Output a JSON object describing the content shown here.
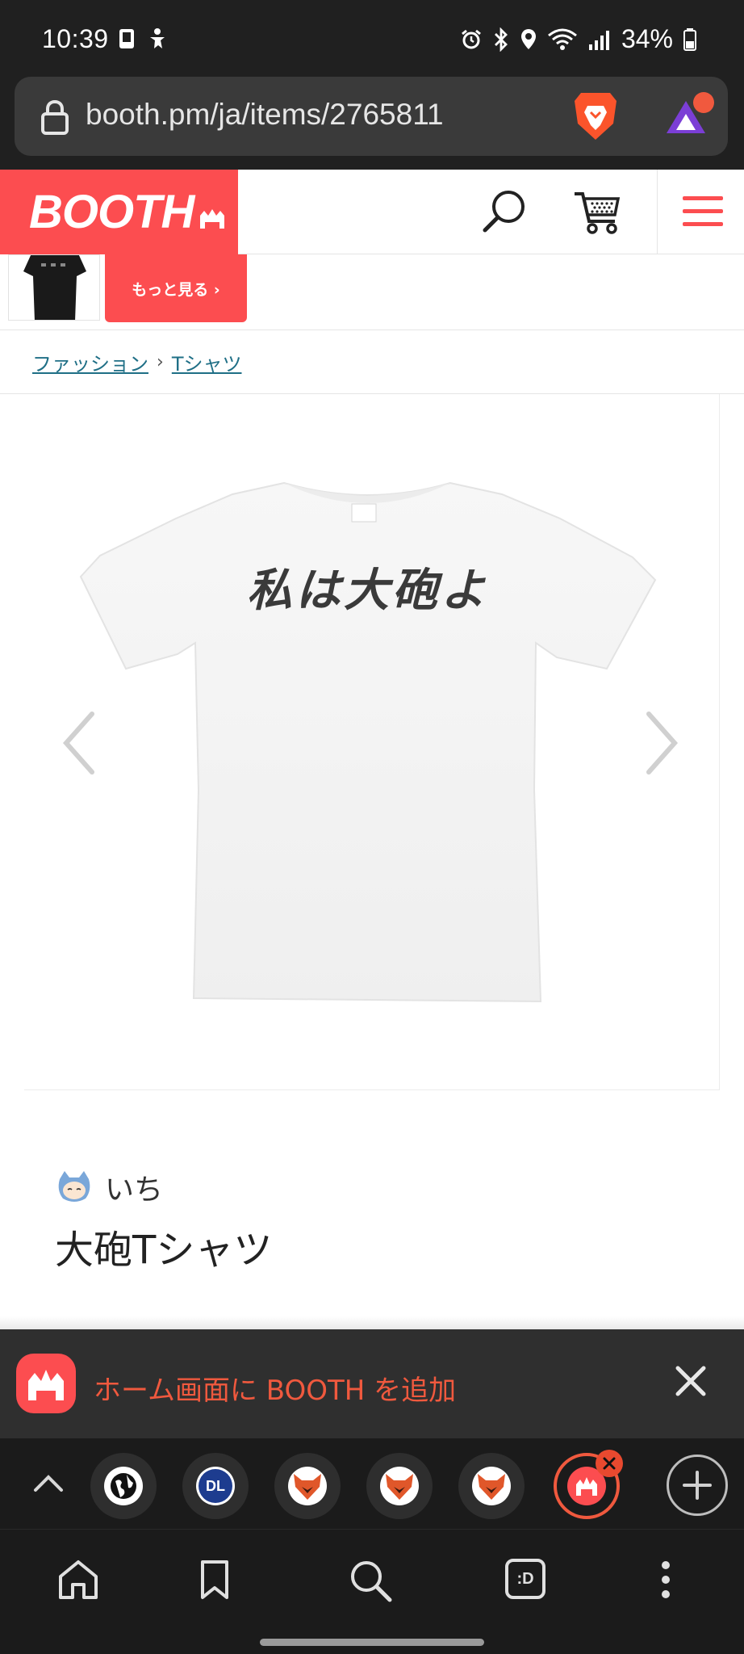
{
  "status_bar": {
    "time": "10:39",
    "battery": "34%"
  },
  "browser": {
    "url": "booth.pm/ja/items/2765811"
  },
  "site": {
    "logo": "BOOTH",
    "more_label": "もっと見る ›",
    "breadcrumb": [
      "ファッション",
      "Tシャツ"
    ],
    "breadcrumb_separator": "›"
  },
  "product": {
    "print_text": "私は大砲よ",
    "shop_name": "いち",
    "title": "大砲Tシャツ"
  },
  "banner": {
    "text": "ホーム画面に BOOTH を追加"
  },
  "tabs": {
    "items": [
      "globe",
      "DL",
      "fox",
      "fox",
      "fox",
      "booth"
    ],
    "dl_label": "DL"
  },
  "bottom_nav": {
    "tabs_label": ":D"
  },
  "colors": {
    "brand": "#fc4d50",
    "link": "#1f6f86",
    "banner_text": "#f0593e",
    "dark_bg": "#1b1b1b"
  }
}
